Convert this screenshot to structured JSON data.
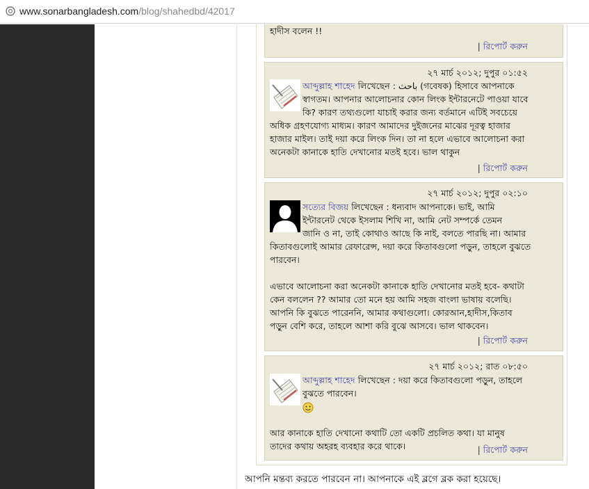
{
  "browser": {
    "url_host": "www.sonarbangladesh.com",
    "url_path": "/blog/shahedbd/42017"
  },
  "comments": [
    {
      "body_lines": [
        "হাদীস বলেন !!"
      ],
      "report": "রিপোর্ট করুন"
    },
    {
      "time": "২৭ মার্চ ২০১২; দুপুর ০১:৫২",
      "author": "আব্দুল্লাহ শাহেদ",
      "says": " লিখেছেন : ",
      "body_lines": [
        "باحث (গবেষক) হিসাবে আপনাকে",
        "স্বাগতম। আপনার আলোচনার কোন লিংক ইন্টারনেটে পাওয়া যাবে",
        "কি? কারণ তথ্যগুলো যাচাই করার জন্য বর্তমানে এটিই সবচেয়ে",
        "অধিক গ্রহণযোগ্য মাধ্যম। কারণ আমাদের দুইজনের মাঝের দূরত্ব হাজার",
        "হাজার মাইল। তাই দয়া করে লিংক দিন। তা না হলে এভাবে আলোচনা করা",
        "অনেকটা কানাকে হাতি দেখানোর মতই হবে। ভাল থাকুন"
      ],
      "report": "রিপোর্ট করুন"
    },
    {
      "time": "২৭ মার্চ ২০১২; দুপুর ০২:১০",
      "author": "সত্যের বিজয়",
      "says": " লিখেছেন : ",
      "body_lines": [
        "ধন্যবাদ আপনাকে। ভাই, আমি",
        "ইন্টারনেট থেকে ইসলাম শিখি না, আমি নেট সম্পর্কে তেমন",
        "জানি ও না, তাই কোথাও আছে কি নাই, বলতে পারছি না। আমার",
        "কিতাবগুলোই আমার রেফারেন্স, দয়া করে কিতাবগুলো পড়ুন, তাহলে বুঝতে",
        "পারবেন।",
        "",
        "এভাবে আলোচনা করা অনেকটা কানাকে হাতি দেখানোর মতই হবে- কথাটা",
        "কেন বললেন ?? আমার তো মনে হয় আমি সহজ বাংলা ভাষায় বলেছি।",
        "আপনি কি বুঝতে পারেননি, আমার কথাগুলো। কোরআন,হাদীস,কিতাব",
        "পড়ুন বেশি করে, তাহলে আশা করি বুঝে আসবে। ভাল থাকবেন।"
      ],
      "report": "রিপোর্ট করুন"
    },
    {
      "time": "২৭ মার্চ ২০১২; রাত ০৮:৫০",
      "author": "আব্দুল্লাহ শাহেদ",
      "says": " লিখেছেন : ",
      "body_lines": [
        "দয়া করে কিতাবগুলো পড়ুন, তাহলে",
        "বুঝতে পারবেন।",
        "",
        "",
        "আর কানাকে হাতি দেখানো কথাটি তো একটি প্রচলিত কথা। যা মানুষ",
        "তাদের কথায় অহরহ ব্যবহার করে থাকে।"
      ],
      "report": "রিপোর্ট করুন"
    }
  ],
  "notice": "আপনি মন্তব্য করতে পারবেন না। আপনাকে এই ব্লগে ব্লক করা হয়েছে।"
}
